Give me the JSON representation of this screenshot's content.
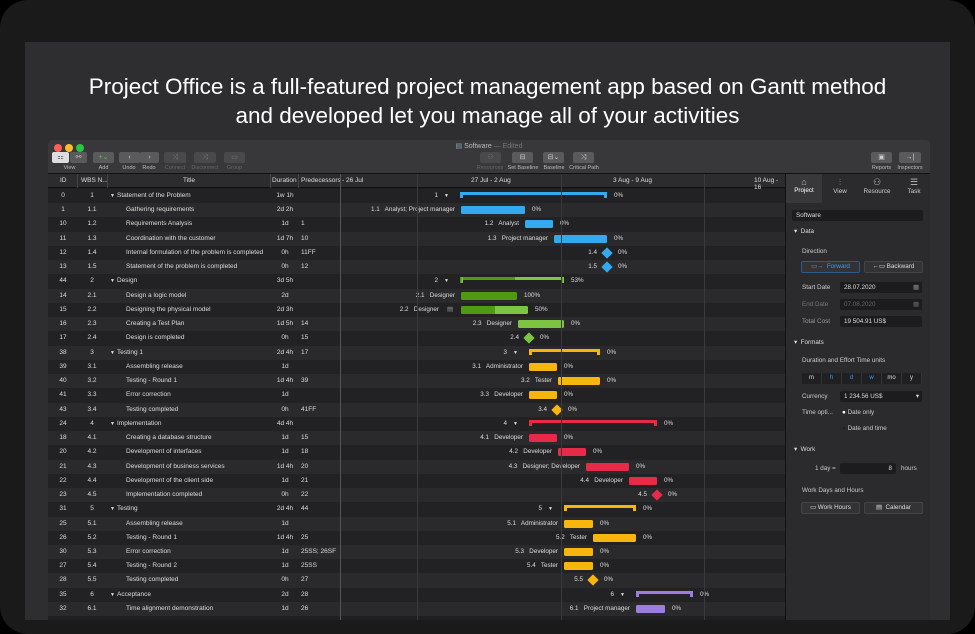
{
  "headline": [
    "Project Office is a full-featured project management app based on Gantt method",
    "and developed  let you manage all of your activities"
  ],
  "window": {
    "title": "Software",
    "status": "— Edited"
  },
  "toolbar": {
    "view": "View",
    "add": "Add",
    "undo": "Undo",
    "redo": "Redo",
    "connect": "Connect",
    "disconnect": "Disconnect",
    "group": "Group",
    "resources": "Resources",
    "set_baseline": "Set Baseline",
    "baseline": "Baseline",
    "critical_path": "Critical Path",
    "reports": "Reports",
    "inspectors": "Inspectors"
  },
  "table": {
    "columns": [
      "ID",
      "WBS N...",
      "Title",
      "Duration",
      "Predecessors"
    ],
    "rows": [
      {
        "id": "0",
        "wbs": "1",
        "title": "Statement of the Problem",
        "dur": "1w 1h",
        "pred": "",
        "group": true
      },
      {
        "id": "1",
        "wbs": "1.1",
        "title": "Gathering requirements",
        "dur": "2d 2h",
        "pred": ""
      },
      {
        "id": "10",
        "wbs": "1.2",
        "title": "Requirements Analysis",
        "dur": "1d",
        "pred": "1"
      },
      {
        "id": "11",
        "wbs": "1.3",
        "title": "Coordination with the customer",
        "dur": "1d 7h",
        "pred": "10"
      },
      {
        "id": "12",
        "wbs": "1.4",
        "title": "Internal formulation of the problem is completed",
        "dur": "0h",
        "pred": "11FF"
      },
      {
        "id": "13",
        "wbs": "1.5",
        "title": "Statement of the problem is completed",
        "dur": "0h",
        "pred": "12"
      },
      {
        "id": "44",
        "wbs": "2",
        "title": "Design",
        "dur": "3d 5h",
        "pred": "",
        "group": true
      },
      {
        "id": "14",
        "wbs": "2.1",
        "title": "Design a logic model",
        "dur": "2d",
        "pred": ""
      },
      {
        "id": "15",
        "wbs": "2.2",
        "title": "Designing the physical model",
        "dur": "2d 3h",
        "pred": ""
      },
      {
        "id": "16",
        "wbs": "2.3",
        "title": "Creating a Test Plan",
        "dur": "1d 5h",
        "pred": "14"
      },
      {
        "id": "17",
        "wbs": "2.4",
        "title": "Design is completed",
        "dur": "0h",
        "pred": "15"
      },
      {
        "id": "38",
        "wbs": "3",
        "title": "Testing 1",
        "dur": "2d 4h",
        "pred": "17",
        "group": true
      },
      {
        "id": "39",
        "wbs": "3.1",
        "title": "Assembling release",
        "dur": "1d",
        "pred": ""
      },
      {
        "id": "40",
        "wbs": "3.2",
        "title": "Testing - Round 1",
        "dur": "1d 4h",
        "pred": "39"
      },
      {
        "id": "41",
        "wbs": "3.3",
        "title": "Error correction",
        "dur": "1d",
        "pred": ""
      },
      {
        "id": "43",
        "wbs": "3.4",
        "title": "Testing completed",
        "dur": "0h",
        "pred": "41FF"
      },
      {
        "id": "24",
        "wbs": "4",
        "title": "Implementation",
        "dur": "4d 4h",
        "pred": "",
        "group": true
      },
      {
        "id": "18",
        "wbs": "4.1",
        "title": "Creating a database structure",
        "dur": "1d",
        "pred": "15"
      },
      {
        "id": "20",
        "wbs": "4.2",
        "title": "Development of interfaces",
        "dur": "1d",
        "pred": "18"
      },
      {
        "id": "21",
        "wbs": "4.3",
        "title": "Development of business services",
        "dur": "1d 4h",
        "pred": "20"
      },
      {
        "id": "22",
        "wbs": "4.4",
        "title": "Development of the client side",
        "dur": "1d",
        "pred": "21"
      },
      {
        "id": "23",
        "wbs": "4.5",
        "title": "Implementation completed",
        "dur": "0h",
        "pred": "22"
      },
      {
        "id": "31",
        "wbs": "5",
        "title": "Testing",
        "dur": "2d 4h",
        "pred": "44",
        "group": true
      },
      {
        "id": "25",
        "wbs": "5.1",
        "title": "Assembling release",
        "dur": "1d",
        "pred": ""
      },
      {
        "id": "26",
        "wbs": "5.2",
        "title": "Testing - Round 1",
        "dur": "1d 4h",
        "pred": "25"
      },
      {
        "id": "30",
        "wbs": "5.3",
        "title": "Error correction",
        "dur": "1d",
        "pred": "25SS; 26SF"
      },
      {
        "id": "27",
        "wbs": "5.4",
        "title": "Testing - Round 2",
        "dur": "1d",
        "pred": "25SS"
      },
      {
        "id": "28",
        "wbs": "5.5",
        "title": "Testing completed",
        "dur": "0h",
        "pred": "27"
      },
      {
        "id": "35",
        "wbs": "6",
        "title": "Acceptance",
        "dur": "2d",
        "pred": "28",
        "group": true
      },
      {
        "id": "32",
        "wbs": "6.1",
        "title": "Time alignment demonstration",
        "dur": "1d",
        "pred": "26"
      }
    ]
  },
  "gantt": {
    "weeks": [
      "- 26 Jul",
      "27 Jul - 2 Aug",
      "3 Aug - 9 Aug",
      "10 Aug - 16"
    ],
    "colors": {
      "blue": "#33aaf0",
      "green_dark": "#4f9a12",
      "green_light": "#7ec443",
      "yellow": "#f7b60e",
      "red": "#e62a48",
      "purple": "#9b7ee0"
    },
    "items": [
      {
        "label": "1",
        "resource": "",
        "pct": "0%",
        "color": "blue"
      },
      {
        "label": "1.1",
        "resource": "Analyst; Project manager",
        "pct": "0%",
        "color": "blue"
      },
      {
        "label": "1.2",
        "resource": "Analyst",
        "pct": "0%",
        "color": "blue"
      },
      {
        "label": "1.3",
        "resource": "Project manager",
        "pct": "0%",
        "color": "blue"
      },
      {
        "label": "1.4",
        "resource": "",
        "pct": "0%",
        "color": "blue"
      },
      {
        "label": "1.5",
        "resource": "",
        "pct": "0%",
        "color": "blue"
      },
      {
        "label": "2",
        "resource": "",
        "pct": "53%",
        "color": "green_light",
        "progress": 0.53
      },
      {
        "label": "2.1",
        "resource": "Designer",
        "pct": "100%",
        "color": "green_light",
        "progress": 1
      },
      {
        "label": "2.2",
        "resource": "Designer",
        "pct": "50%",
        "color": "green_light",
        "progress": 0.5,
        "note_icon": "note-icon"
      },
      {
        "label": "2.3",
        "resource": "Designer",
        "pct": "0%",
        "color": "green_light"
      },
      {
        "label": "2.4",
        "resource": "",
        "pct": "0%",
        "color": "green_light"
      },
      {
        "label": "3",
        "resource": "",
        "pct": "0%",
        "color": "yellow"
      },
      {
        "label": "3.1",
        "resource": "Administrator",
        "pct": "0%",
        "color": "yellow"
      },
      {
        "label": "3.2",
        "resource": "Tester",
        "pct": "0%",
        "color": "yellow"
      },
      {
        "label": "3.3",
        "resource": "Developer",
        "pct": "0%",
        "color": "yellow"
      },
      {
        "label": "3.4",
        "resource": "",
        "pct": "0%",
        "color": "yellow"
      },
      {
        "label": "4",
        "resource": "",
        "pct": "0%",
        "color": "red"
      },
      {
        "label": "4.1",
        "resource": "Developer",
        "pct": "0%",
        "color": "red"
      },
      {
        "label": "4.2",
        "resource": "Developer",
        "pct": "0%",
        "color": "red"
      },
      {
        "label": "4.3",
        "resource": "Designer; Developer",
        "pct": "0%",
        "color": "red"
      },
      {
        "label": "4.4",
        "resource": "Developer",
        "pct": "0%",
        "color": "red"
      },
      {
        "label": "4.5",
        "resource": "",
        "pct": "0%",
        "color": "red"
      },
      {
        "label": "5",
        "resource": "",
        "pct": "0%",
        "color": "yellow"
      },
      {
        "label": "5.1",
        "resource": "Administrator",
        "pct": "0%",
        "color": "yellow"
      },
      {
        "label": "5.2",
        "resource": "Tester",
        "pct": "0%",
        "color": "yellow"
      },
      {
        "label": "5.3",
        "resource": "Developer",
        "pct": "0%",
        "color": "yellow"
      },
      {
        "label": "5.4",
        "resource": "Tester",
        "pct": "0%",
        "color": "yellow"
      },
      {
        "label": "5.5",
        "resource": "",
        "pct": "0%",
        "color": "yellow"
      },
      {
        "label": "6",
        "resource": "",
        "pct": "0%",
        "color": "purple"
      },
      {
        "label": "6.1",
        "resource": "Project manager",
        "pct": "0%",
        "color": "purple"
      }
    ]
  },
  "inspector": {
    "tabs": [
      "Project",
      "View",
      "Resource",
      "Task"
    ],
    "selected_tab": "Project",
    "project_name": "Software",
    "data_section": "Data",
    "direction_label": "Direction",
    "forward": "Forward",
    "backward": "Backward",
    "start_date_label": "Start Date",
    "start_date": "28.07.2020",
    "end_date_label": "End Date",
    "end_date": "07.08.2020",
    "total_cost_label": "Total Cost",
    "total_cost": "19 504.91 US$",
    "formats_section": "Formats",
    "units_label": "Duration and Effort Time units",
    "units": [
      "m",
      "h",
      "d",
      "w",
      "mo",
      "y"
    ],
    "currency_label": "Currency",
    "currency": "1 234.56 US$",
    "time_label": "Time opti...",
    "date_only": "Date only",
    "date_and_time": "Date and time",
    "work_section": "Work",
    "day_label": "1 day =",
    "day_hours": "8",
    "hours_label": "hours",
    "workdays_label": "Work Days and Hours",
    "work_hours_btn": "Work Hours",
    "calendar_btn": "Calendar"
  }
}
